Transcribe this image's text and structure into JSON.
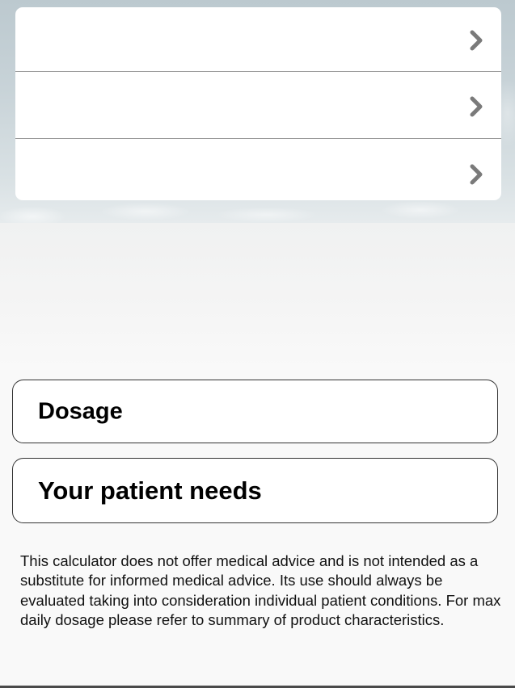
{
  "menu": {
    "rows": [
      {
        "label": "",
        "icon": "chevron-right-icon"
      },
      {
        "label": "",
        "icon": "chevron-right-icon"
      },
      {
        "label": "",
        "icon": "chevron-right-icon"
      }
    ]
  },
  "buttons": {
    "dosage_label": "Dosage",
    "patient_needs_label": "Your patient needs"
  },
  "disclaimer": {
    "text": "This calculator does not offer medical advice and is not intended as a substitute for informed medical advice. Its use should always be evaluated taking into consideration individual patient conditions. For max daily dosage please refer to summary of product characteristics."
  },
  "colors": {
    "card_bg": "#ffffff",
    "chevron": "#7a7a7a",
    "divider": "#9a9a9a",
    "button_border": "#333333",
    "page_bg": "#f9f9f9"
  }
}
